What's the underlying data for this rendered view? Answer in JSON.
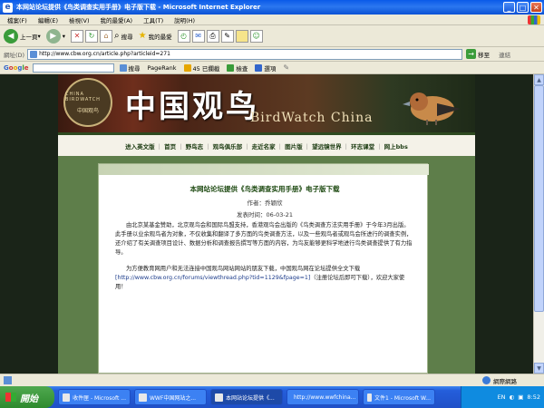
{
  "window": {
    "title": "本网站论坛提供《鸟类调查实用手册》电子版下载 - Microsoft Internet Explorer"
  },
  "menu": [
    "檔案(F)",
    "編輯(E)",
    "檢視(V)",
    "我的最愛(A)",
    "工具(T)",
    "說明(H)"
  ],
  "toolbar": {
    "back_label": "上一頁",
    "search_label": "搜尋",
    "favorites_label": "我的最愛"
  },
  "address": {
    "label": "網址(D)",
    "url": "http://www.cbw.org.cn/article.php?articleid=271",
    "go_label": "移至",
    "links_label": "連結"
  },
  "googlebar": {
    "logo": "Google",
    "search_label": "搜尋",
    "pagerank_label": "PageRank",
    "blocked_label": "45 已攔截",
    "check_label": "檢查",
    "options_label": "選項"
  },
  "site": {
    "logo_en": "CHINA BIRDWATCH",
    "logo_zh": "中国观鸟",
    "title_cn": "中国观鸟",
    "title_en": "BirdWatch China",
    "nav": [
      "进入英文版",
      "首页",
      "野鸟志",
      "观鸟俱乐部",
      "走近名家",
      "图片版",
      "望远镜世界",
      "环志课堂",
      "网上bbs"
    ]
  },
  "article": {
    "title": "本网站论坛提供《鸟类调查实用手册》电子版下载",
    "author": "作者：乔颖欣",
    "date": "发表时间：06-03-21",
    "para1": "由北京某基金赞助，北京观鸟会和国际鸟盟支持，香港观鸟会出版的《鸟类调查方法实用手册》于今年3月出版。此手册以业余观鸟者为对象，不仅收集和翻译了多方面的鸟类调查方法，以及一些观鸟者或观鸟会所进行的调查实例，还介绍了有关调查项目设计、数据分析和调查报告撰写等方面的内容，为鸟友能够更科学地进行鸟类调查提供了有力指导。",
    "para2_lead": "为方便教育网用户和无法连接中国观鸟网站网站的朋友下载，中国观鸟网在论坛提供全文下载",
    "para2_link": "[http://www.cbw.org.cn/forums/viewthread.php?tid=1129&fpage=1]",
    "para2_tail": "（注册论坛后即可下载），欢迎大家使用！"
  },
  "status": {
    "zone": "網際網路"
  },
  "taskbar": {
    "start": "開始",
    "tasks": [
      "收件匣 - Microsoft ...",
      "WWF中国网站之...",
      "本网站论坛提供《...",
      "http://www.wwfchina...",
      "文件1 - Microsoft W..."
    ],
    "active_index": 2,
    "lang": "EN",
    "clock": "8:52"
  }
}
